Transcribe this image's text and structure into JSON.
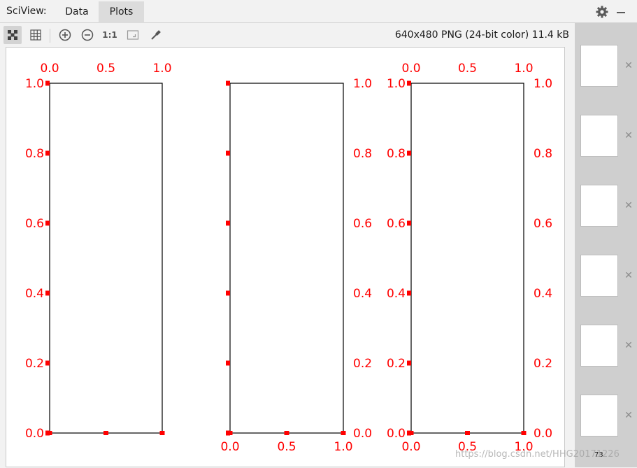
{
  "header": {
    "app_label": "SciView:",
    "tabs": [
      {
        "label": "Data"
      },
      {
        "label": "Plots"
      }
    ],
    "active_tab": "Plots"
  },
  "toolbar": {
    "actual_size_label": "1:1",
    "image_info": "640x480 PNG (24-bit color) 11.4 kB"
  },
  "icons": {
    "fit": "fit-to-window-icon",
    "grid": "grid-icon",
    "zoom_in": "zoom-in-icon",
    "zoom_out": "zoom-out-icon",
    "window": "window-icon",
    "picker": "color-picker-icon",
    "settings": "gear-icon",
    "minimize": "minimize-icon",
    "close": "close-icon"
  },
  "colors": {
    "tick": "#ff0000",
    "axes": "#000000"
  },
  "thumbnails": {
    "count_label": "73"
  },
  "watermark": "https://blog.csdn.net/HHG20171226",
  "chart_data": [
    {
      "type": "line",
      "series": [],
      "xlim": [
        0.0,
        1.0
      ],
      "ylim": [
        0.0,
        1.0
      ],
      "xticks": [
        "0.0",
        "0.5",
        "1.0"
      ],
      "yticks": [
        "0.0",
        "0.2",
        "0.4",
        "0.6",
        "0.8",
        "1.0"
      ],
      "xtick_labels_position": "top",
      "ytick_labels_position": "left",
      "tick_color": "#ff0000",
      "grid": false
    },
    {
      "type": "line",
      "series": [],
      "xlim": [
        0.0,
        1.0
      ],
      "ylim": [
        0.0,
        1.0
      ],
      "xticks": [
        "0.0",
        "0.5",
        "1.0"
      ],
      "yticks": [
        "0.0",
        "0.2",
        "0.4",
        "0.6",
        "0.8",
        "1.0"
      ],
      "xtick_labels_position": "bottom",
      "ytick_labels_position": "right",
      "tick_color": "#ff0000",
      "grid": false
    },
    {
      "type": "line",
      "series": [],
      "xlim": [
        0.0,
        1.0
      ],
      "ylim": [
        0.0,
        1.0
      ],
      "xticks": [
        "0.0",
        "0.5",
        "1.0"
      ],
      "yticks": [
        "0.0",
        "0.2",
        "0.4",
        "0.6",
        "0.8",
        "1.0"
      ],
      "xtick_labels_position": "both",
      "ytick_labels_position": "both",
      "tick_color": "#ff0000",
      "grid": false
    }
  ]
}
